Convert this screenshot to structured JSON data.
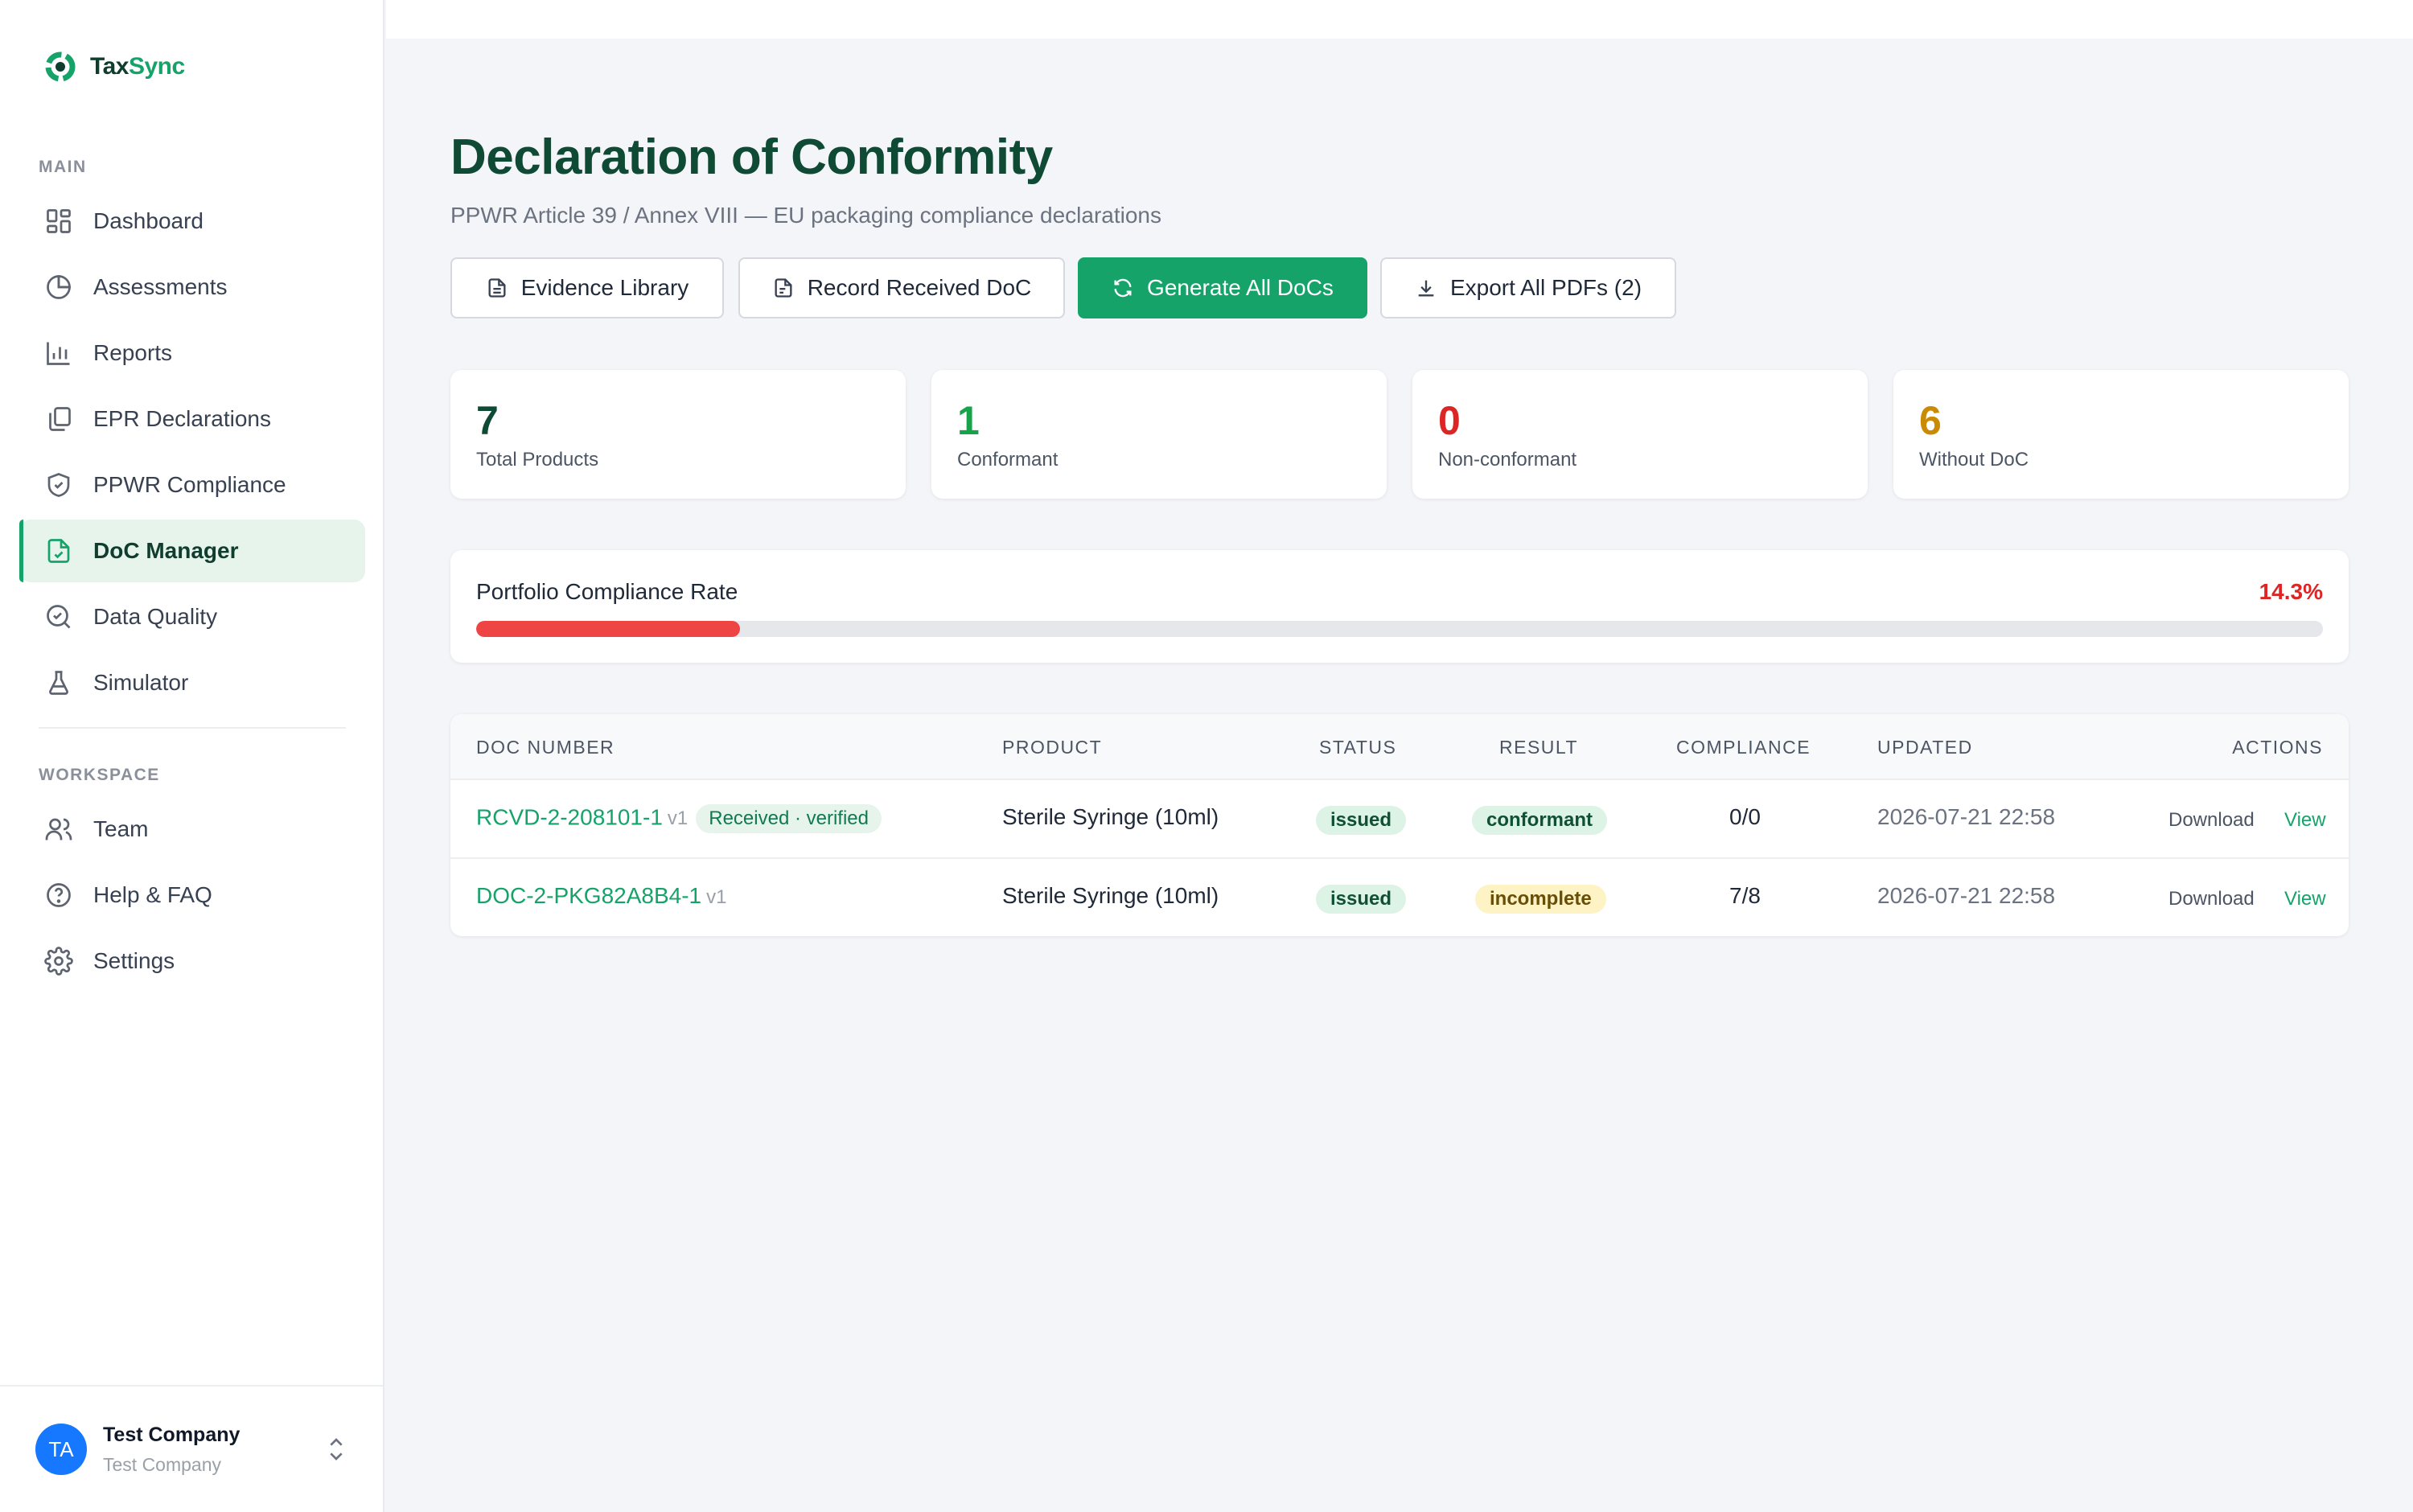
{
  "app": {
    "brand_part1": "Tax",
    "brand_part2": "Sync",
    "brand_color": "#16a36a"
  },
  "sidebar": {
    "main_label": "MAIN",
    "workspace_label": "WORKSPACE",
    "main_items": [
      {
        "label": "Dashboard",
        "icon": "grid-icon"
      },
      {
        "label": "Assessments",
        "icon": "pie-chart-icon"
      },
      {
        "label": "Reports",
        "icon": "bar-chart-icon"
      },
      {
        "label": "EPR Declarations",
        "icon": "copy-icon"
      },
      {
        "label": "PPWR Compliance",
        "icon": "shield-check-icon"
      },
      {
        "label": "DoC Manager",
        "icon": "file-check-icon",
        "active": true
      },
      {
        "label": "Data Quality",
        "icon": "search-check-icon"
      },
      {
        "label": "Simulator",
        "icon": "flask-icon"
      }
    ],
    "workspace_items": [
      {
        "label": "Team",
        "icon": "users-icon"
      },
      {
        "label": "Help & FAQ",
        "icon": "help-circle-icon"
      },
      {
        "label": "Settings",
        "icon": "gear-icon"
      }
    ],
    "user": {
      "initials": "TA",
      "name": "Test Company",
      "org": "Test Company"
    }
  },
  "page": {
    "title": "Declaration of Conformity",
    "subtitle": "PPWR Article 39 / Annex VIII — EU packaging compliance declarations"
  },
  "toolbar": {
    "evidence_label": "Evidence Library",
    "record_label": "Record Received DoC",
    "generate_label": "Generate All DoCs",
    "export_label": "Export All PDFs (2)"
  },
  "stats": [
    {
      "value": "7",
      "label": "Total Products",
      "color": "#0f4a34"
    },
    {
      "value": "1",
      "label": "Conformant",
      "color": "#16a34a"
    },
    {
      "value": "0",
      "label": "Non-conformant",
      "color": "#dc2626"
    },
    {
      "value": "6",
      "label": "Without DoC",
      "color": "#ca8a04"
    }
  ],
  "compliance_rate": {
    "label": "Portfolio Compliance Rate",
    "value_text": "14.3%",
    "fraction": 0.143
  },
  "table": {
    "headers": {
      "doc_number": "DOC NUMBER",
      "product": "PRODUCT",
      "status": "STATUS",
      "result": "RESULT",
      "compliance": "COMPLIANCE",
      "updated": "UPDATED",
      "actions": "ACTIONS"
    },
    "rows": [
      {
        "doc_number": "RCVD-2-208101-1",
        "version": "v1",
        "tag": "Received · verified",
        "product": "Sterile Syringe (10ml)",
        "status": "issued",
        "result": "conformant",
        "compliance": "0/0",
        "updated": "2026-07-21 22:58",
        "download": "Download",
        "view": "View"
      },
      {
        "doc_number": "DOC-2-PKG82A8B4-1",
        "version": "v1",
        "product": "Sterile Syringe (10ml)",
        "status": "issued",
        "result": "incomplete",
        "compliance": "7/8",
        "updated": "2026-07-21 22:58",
        "download": "Download",
        "view": "View"
      }
    ]
  }
}
